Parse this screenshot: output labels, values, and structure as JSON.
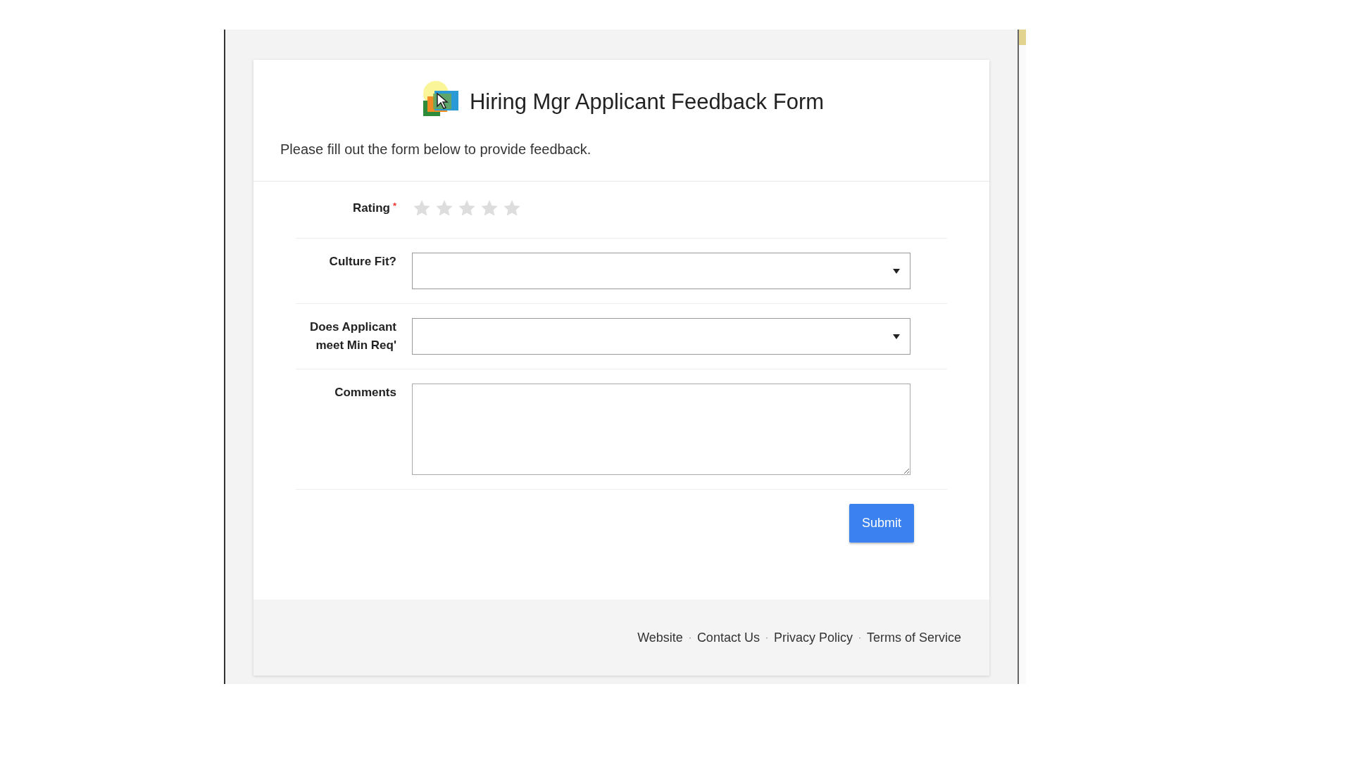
{
  "header": {
    "title": "Hiring Mgr Applicant Feedback Form",
    "description": "Please fill out the form below to provide feedback."
  },
  "fields": [
    {
      "kind": "rating",
      "label": "Rating",
      "required_mark": "*",
      "stars": 0
    },
    {
      "kind": "select",
      "label": "Culture Fit?"
    },
    {
      "kind": "select",
      "label": "Does Applicant meet Min Req'"
    },
    {
      "kind": "textarea",
      "label": "Comments"
    }
  ],
  "submit": "Submit",
  "footer": {
    "separator": "·",
    "links": [
      "Website",
      "Contact Us",
      "Privacy Policy",
      "Terms of Service"
    ]
  }
}
